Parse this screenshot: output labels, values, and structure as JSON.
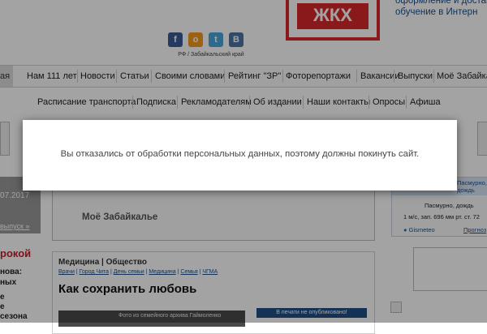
{
  "header": {
    "brand_badge": "ЖКХ",
    "promo_lines": [
      "оформление и доставка",
      "обучение в Интерн"
    ],
    "region": "РФ / Забайкальский край",
    "social": [
      {
        "icon": "facebook-icon",
        "glyph": "f",
        "color": "#3b5998"
      },
      {
        "icon": "odnoklassniki-icon",
        "glyph": "о",
        "color": "#f59a1d"
      },
      {
        "icon": "twitter-icon",
        "glyph": "t",
        "color": "#49a7dc"
      },
      {
        "icon": "vkontakte-icon",
        "glyph": "В",
        "color": "#4c75a3"
      }
    ]
  },
  "nav_primary": {
    "home_partial": "ая",
    "items": [
      "Нам 111 лет",
      "Новости",
      "Статьи",
      "Своими словами",
      "Рейтинг \"ЗР\"",
      "Фоторепортажи",
      "Вакансии",
      "Выпуски",
      "Моё Забайка"
    ]
  },
  "nav_secondary": {
    "items": [
      "Расписание транспорта",
      "Подписка",
      "Рекламодателям",
      "Об издании",
      "Наши контакты",
      "Опросы",
      "Афиша"
    ]
  },
  "left_column": {
    "date": "07.2017",
    "all_issues": "выпуск »",
    "rubric": "рокой",
    "lines": [
      "нова:",
      "ных",
      "е",
      "е",
      "сезона"
    ]
  },
  "center": {
    "moe_zabaikalie": "Моё Забайкалье",
    "category": "Медицина | Общество",
    "tags": [
      "Врачи",
      "Город Чита",
      "День семьи",
      "Медицина",
      "Семья",
      "ЧГМА"
    ],
    "article_title": "Как сохранить любовь",
    "photo_caption": "Фото из семейного архива Гаймоленко",
    "print_status": "В печати не опубликовано!"
  },
  "weather": {
    "top_text": "Пасмурно, дождь",
    "condition": "Пасмурно, дождь",
    "details": "1 м/с, зап.  696 мм рт. ст.  72",
    "provider": "Gismeteo",
    "forecast_link": "Прогноз"
  },
  "modal": {
    "message": "Вы отказались от обработки персональных данных, поэтому должны покинуть сайт."
  }
}
